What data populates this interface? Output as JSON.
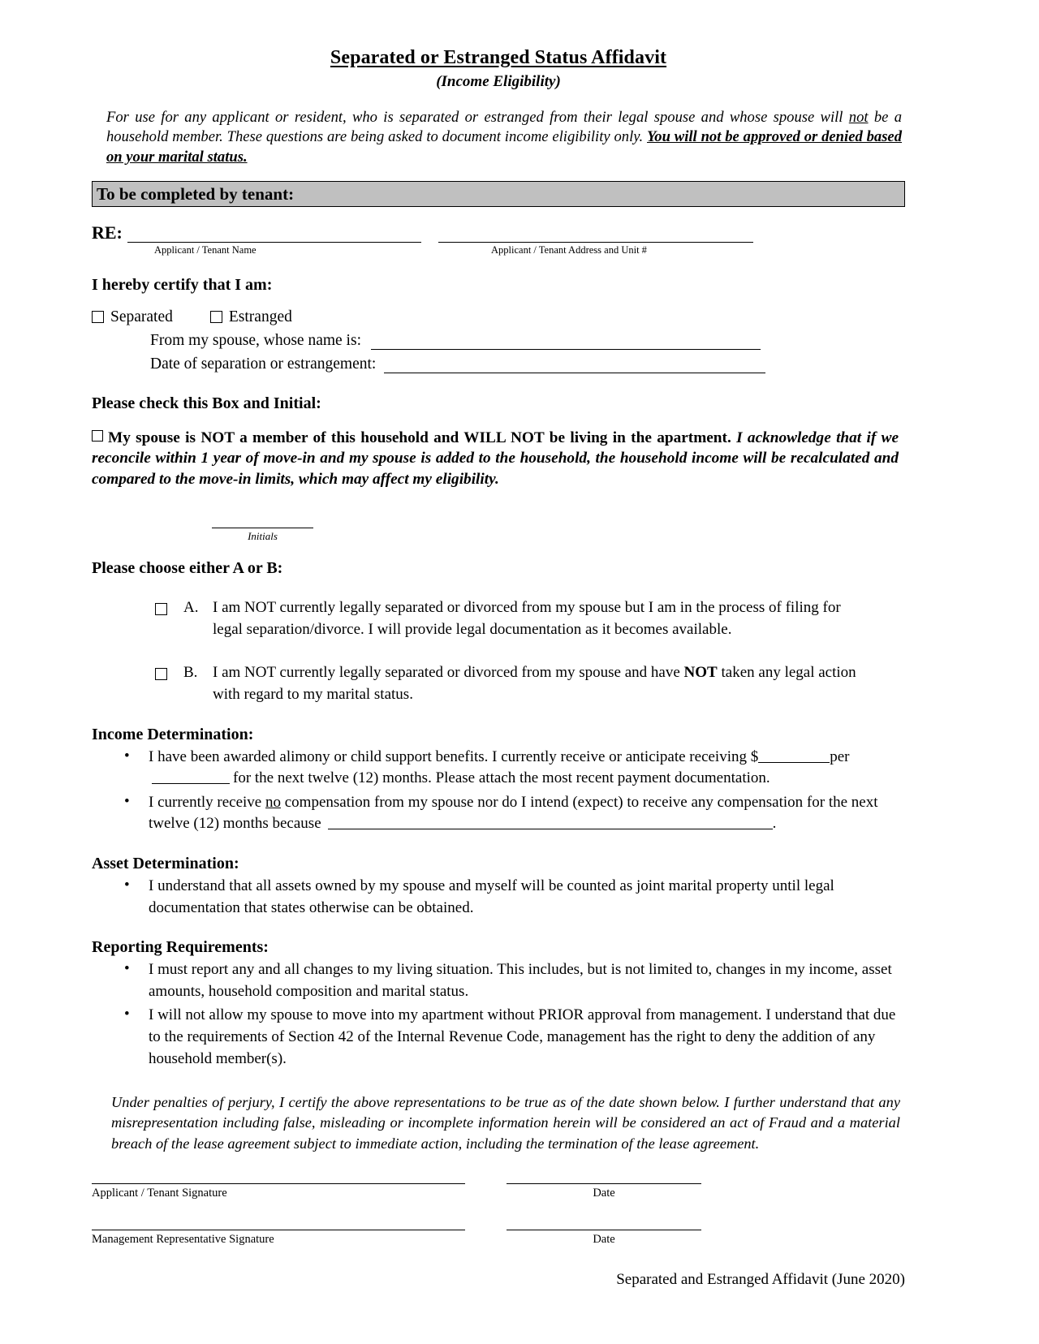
{
  "document": {
    "title": "Separated or Estranged Status Affidavit",
    "subtitle": "(Income Eligibility)",
    "intro": {
      "part1": "For use for any applicant or resident, who is separated or estranged from their legal spouse and whose spouse will ",
      "underlined1": "not",
      "part2": " be a household member. These questions are being asked to document income eligibility only. ",
      "bold_underlined": "You will not be approved or denied based on your marital status."
    },
    "section_bar": "To be completed by tenant:",
    "re": {
      "label": "RE:",
      "caption_name": "Applicant / Tenant Name",
      "caption_address": "Applicant / Tenant Address and Unit #"
    },
    "certify": {
      "heading": "I hereby certify that I am:",
      "option_separated": "Separated",
      "option_estranged": "Estranged",
      "spouse_name_label": "From my spouse, whose name is:",
      "date_label": "Date of separation or estrangement:"
    },
    "check_initial": {
      "heading": "Please check this Box and Initial:",
      "bold_text": "My spouse is NOT a member of this household and WILL NOT be living in the apartment.",
      "italic_text": " I acknowledge that if we reconcile within 1 year of move-in and my spouse is added to the household, the household income will be recalculated and compared to the move-in limits, which may affect my eligibility.",
      "initials_caption": "Initials"
    },
    "choose_ab": {
      "heading": "Please choose either A or B:",
      "items": [
        {
          "letter": "A.",
          "text": "I am NOT currently legally separated or divorced from my spouse but I am in the process of filing for legal separation/divorce. I will provide legal documentation as it becomes available."
        },
        {
          "letter": "B.",
          "text_part1": "I am NOT currently legally separated or divorced from my spouse and have ",
          "text_bold": "NOT",
          "text_part2": " taken any legal action with regard to my marital status."
        }
      ]
    },
    "income_determination": {
      "heading": "Income Determination:",
      "bullet1_part1": "I have been awarded alimony or child support benefits. I currently receive or anticipate receiving $",
      "bullet1_per": "per",
      "bullet1_part2": "for the next twelve (12) months. Please attach the most recent payment documentation.",
      "bullet2_part1": "I currently receive ",
      "bullet2_underlined": "no",
      "bullet2_part2": " compensation from my spouse nor do I intend (expect) to receive any compensation for the next twelve (12) months because",
      "bullet2_end": "."
    },
    "asset_determination": {
      "heading": "Asset Determination:",
      "bullet1": "I understand that all assets owned by my spouse and myself will be counted as joint marital property until legal documentation that states otherwise can be obtained."
    },
    "reporting_requirements": {
      "heading": "Reporting Requirements:",
      "bullet1": "I must report any and all changes to my living situation. This includes, but is not limited to, changes in my income, asset amounts, household composition and marital status.",
      "bullet2": "I will not allow my spouse to move into my apartment without PRIOR approval from management. I understand that due to the requirements of Section 42 of the Internal Revenue Code, management has the right to deny the addition of any household member(s)."
    },
    "perjury": "Under penalties of perjury, I certify the above representations to be true as of the date shown below. I further understand that any misrepresentation including false, misleading or incomplete information herein will be considered an act of Fraud and a material breach of the lease agreement subject to immediate action, including the termination of the lease agreement.",
    "signatures": {
      "applicant_caption": "Applicant / Tenant Signature",
      "date_caption_1": "Date",
      "management_caption": "Management Representative Signature",
      "date_caption_2": "Date"
    },
    "footer": "Separated and Estranged Affidavit (June 2020)"
  }
}
